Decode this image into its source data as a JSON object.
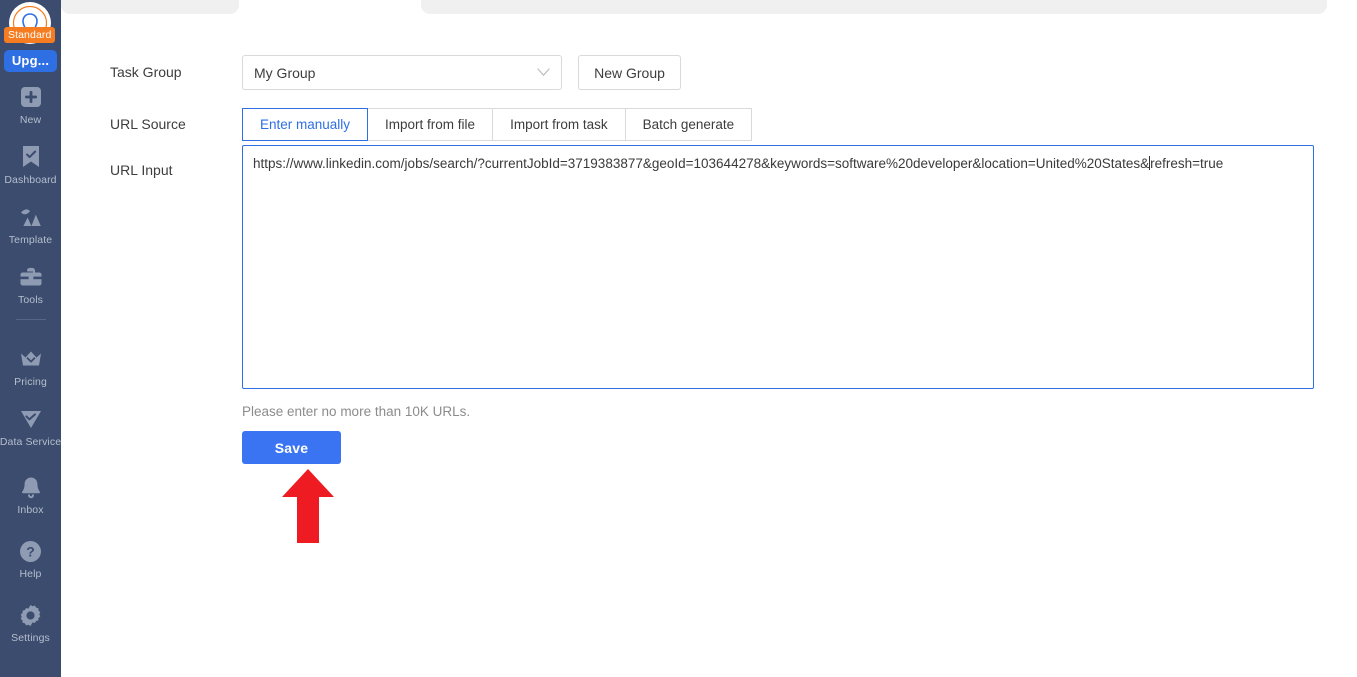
{
  "sidebar": {
    "avatar": {
      "name": "user-avatar",
      "plan_badge": "Standard"
    },
    "upgrade_label": "Upg...",
    "items": [
      {
        "label": "New",
        "icon": "plus-square-icon"
      },
      {
        "label": "Dashboard",
        "icon": "bookmark-check-icon"
      },
      {
        "label": "Template",
        "icon": "template-icon"
      },
      {
        "label": "Tools",
        "icon": "toolbox-icon"
      },
      {
        "label": "Pricing",
        "icon": "crown-icon"
      },
      {
        "label": "Data Service",
        "icon": "shield-check-icon"
      },
      {
        "label": "Inbox",
        "icon": "bell-icon"
      },
      {
        "label": "Help",
        "icon": "question-circle-icon"
      },
      {
        "label": "Settings",
        "icon": "gear-icon"
      }
    ]
  },
  "form": {
    "task_group": {
      "label": "Task Group",
      "selected": "My Group",
      "new_group_button": "New Group"
    },
    "url_source": {
      "label": "URL Source",
      "options": [
        "Enter manually",
        "Import from file",
        "Import from task",
        "Batch generate"
      ],
      "active": "Enter manually"
    },
    "url_input": {
      "label": "URL Input",
      "value_before_caret": "https://www.linkedin.com/jobs/search/?currentJobId=3719383877&geoId=103644278&keywords=software%20developer&location=United%20States&",
      "value_after_caret": "refresh=true",
      "full_value": "https://www.linkedin.com/jobs/search/?currentJobId=3719383877&geoId=103644278&keywords=software%20developer&location=United%20States&refresh=true",
      "hint": "Please enter no more than 10K URLs."
    },
    "save_button": "Save"
  },
  "annotation": {
    "arrow": "red-up-arrow",
    "points_at": "Save"
  },
  "colors": {
    "sidebar_bg": "#3b4c6e",
    "accent_blue": "#2f6fe4",
    "save_blue": "#3b74f2",
    "badge_orange": "#f57c20",
    "arrow_red": "#ee1b22",
    "tab_gray": "#f0f0f0"
  }
}
